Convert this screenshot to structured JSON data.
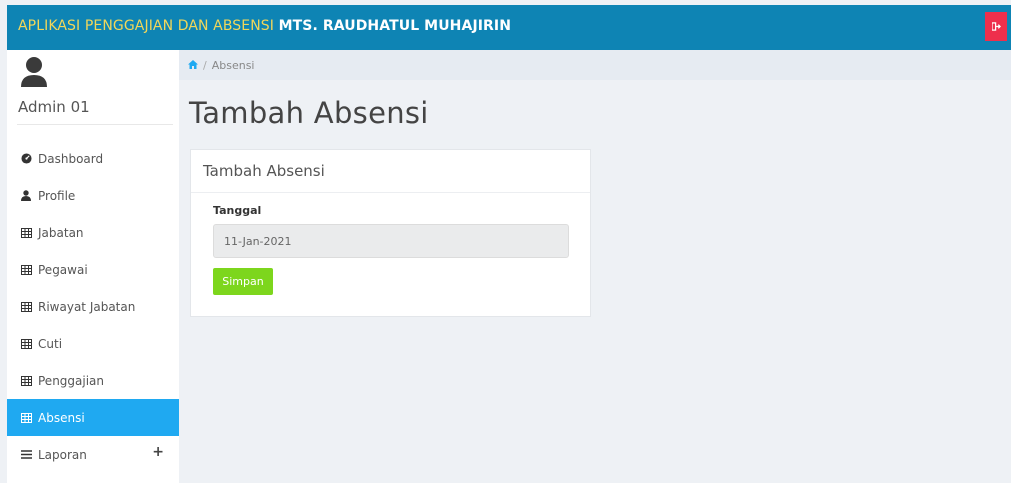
{
  "header": {
    "title_part1": "APLIKASI PENGGAJIAN DAN ABSENSI",
    "title_part2": "MTS. RAUDHATUL MUHAJIRIN",
    "logout_icon": "sign-out-icon",
    "colors": {
      "bar": "#0e84b4",
      "logout": "#ee2f4c"
    }
  },
  "sidebar": {
    "user_name": "Admin 01",
    "avatar_icon": "user-icon",
    "items": [
      {
        "label": "Dashboard",
        "icon": "dashboard-icon"
      },
      {
        "label": "Profile",
        "icon": "user-icon"
      },
      {
        "label": "Jabatan",
        "icon": "table-icon"
      },
      {
        "label": "Pegawai",
        "icon": "table-icon"
      },
      {
        "label": "Riwayat Jabatan",
        "icon": "table-icon"
      },
      {
        "label": "Cuti",
        "icon": "table-icon"
      },
      {
        "label": "Penggajian",
        "icon": "table-icon"
      },
      {
        "label": "Absensi",
        "icon": "table-icon",
        "active": true
      },
      {
        "label": "Laporan",
        "icon": "bars-icon",
        "expand": "+"
      }
    ],
    "active_color": "#1fa9f1"
  },
  "breadcrumb": {
    "home_icon": "home-icon",
    "separator": "/",
    "current": "Absensi"
  },
  "page": {
    "title": "Tambah Absensi"
  },
  "card": {
    "title": "Tambah Absensi",
    "field_label": "Tanggal",
    "date_value": "11-Jan-2021",
    "save_label": "Simpan",
    "save_color": "#7dd61d"
  }
}
